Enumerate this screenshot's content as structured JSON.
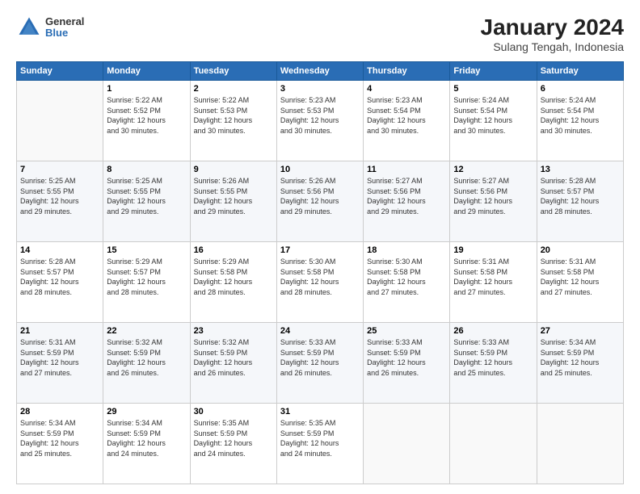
{
  "header": {
    "logo": {
      "general": "General",
      "blue": "Blue"
    },
    "title": "January 2024",
    "subtitle": "Sulang Tengah, Indonesia"
  },
  "calendar": {
    "days_of_week": [
      "Sunday",
      "Monday",
      "Tuesday",
      "Wednesday",
      "Thursday",
      "Friday",
      "Saturday"
    ],
    "weeks": [
      [
        {
          "day": "",
          "info": ""
        },
        {
          "day": "1",
          "info": "Sunrise: 5:22 AM\nSunset: 5:52 PM\nDaylight: 12 hours\nand 30 minutes."
        },
        {
          "day": "2",
          "info": "Sunrise: 5:22 AM\nSunset: 5:53 PM\nDaylight: 12 hours\nand 30 minutes."
        },
        {
          "day": "3",
          "info": "Sunrise: 5:23 AM\nSunset: 5:53 PM\nDaylight: 12 hours\nand 30 minutes."
        },
        {
          "day": "4",
          "info": "Sunrise: 5:23 AM\nSunset: 5:54 PM\nDaylight: 12 hours\nand 30 minutes."
        },
        {
          "day": "5",
          "info": "Sunrise: 5:24 AM\nSunset: 5:54 PM\nDaylight: 12 hours\nand 30 minutes."
        },
        {
          "day": "6",
          "info": "Sunrise: 5:24 AM\nSunset: 5:54 PM\nDaylight: 12 hours\nand 30 minutes."
        }
      ],
      [
        {
          "day": "7",
          "info": "Sunrise: 5:25 AM\nSunset: 5:55 PM\nDaylight: 12 hours\nand 29 minutes."
        },
        {
          "day": "8",
          "info": "Sunrise: 5:25 AM\nSunset: 5:55 PM\nDaylight: 12 hours\nand 29 minutes."
        },
        {
          "day": "9",
          "info": "Sunrise: 5:26 AM\nSunset: 5:55 PM\nDaylight: 12 hours\nand 29 minutes."
        },
        {
          "day": "10",
          "info": "Sunrise: 5:26 AM\nSunset: 5:56 PM\nDaylight: 12 hours\nand 29 minutes."
        },
        {
          "day": "11",
          "info": "Sunrise: 5:27 AM\nSunset: 5:56 PM\nDaylight: 12 hours\nand 29 minutes."
        },
        {
          "day": "12",
          "info": "Sunrise: 5:27 AM\nSunset: 5:56 PM\nDaylight: 12 hours\nand 29 minutes."
        },
        {
          "day": "13",
          "info": "Sunrise: 5:28 AM\nSunset: 5:57 PM\nDaylight: 12 hours\nand 28 minutes."
        }
      ],
      [
        {
          "day": "14",
          "info": "Sunrise: 5:28 AM\nSunset: 5:57 PM\nDaylight: 12 hours\nand 28 minutes."
        },
        {
          "day": "15",
          "info": "Sunrise: 5:29 AM\nSunset: 5:57 PM\nDaylight: 12 hours\nand 28 minutes."
        },
        {
          "day": "16",
          "info": "Sunrise: 5:29 AM\nSunset: 5:58 PM\nDaylight: 12 hours\nand 28 minutes."
        },
        {
          "day": "17",
          "info": "Sunrise: 5:30 AM\nSunset: 5:58 PM\nDaylight: 12 hours\nand 28 minutes."
        },
        {
          "day": "18",
          "info": "Sunrise: 5:30 AM\nSunset: 5:58 PM\nDaylight: 12 hours\nand 27 minutes."
        },
        {
          "day": "19",
          "info": "Sunrise: 5:31 AM\nSunset: 5:58 PM\nDaylight: 12 hours\nand 27 minutes."
        },
        {
          "day": "20",
          "info": "Sunrise: 5:31 AM\nSunset: 5:58 PM\nDaylight: 12 hours\nand 27 minutes."
        }
      ],
      [
        {
          "day": "21",
          "info": "Sunrise: 5:31 AM\nSunset: 5:59 PM\nDaylight: 12 hours\nand 27 minutes."
        },
        {
          "day": "22",
          "info": "Sunrise: 5:32 AM\nSunset: 5:59 PM\nDaylight: 12 hours\nand 26 minutes."
        },
        {
          "day": "23",
          "info": "Sunrise: 5:32 AM\nSunset: 5:59 PM\nDaylight: 12 hours\nand 26 minutes."
        },
        {
          "day": "24",
          "info": "Sunrise: 5:33 AM\nSunset: 5:59 PM\nDaylight: 12 hours\nand 26 minutes."
        },
        {
          "day": "25",
          "info": "Sunrise: 5:33 AM\nSunset: 5:59 PM\nDaylight: 12 hours\nand 26 minutes."
        },
        {
          "day": "26",
          "info": "Sunrise: 5:33 AM\nSunset: 5:59 PM\nDaylight: 12 hours\nand 25 minutes."
        },
        {
          "day": "27",
          "info": "Sunrise: 5:34 AM\nSunset: 5:59 PM\nDaylight: 12 hours\nand 25 minutes."
        }
      ],
      [
        {
          "day": "28",
          "info": "Sunrise: 5:34 AM\nSunset: 5:59 PM\nDaylight: 12 hours\nand 25 minutes."
        },
        {
          "day": "29",
          "info": "Sunrise: 5:34 AM\nSunset: 5:59 PM\nDaylight: 12 hours\nand 24 minutes."
        },
        {
          "day": "30",
          "info": "Sunrise: 5:35 AM\nSunset: 5:59 PM\nDaylight: 12 hours\nand 24 minutes."
        },
        {
          "day": "31",
          "info": "Sunrise: 5:35 AM\nSunset: 5:59 PM\nDaylight: 12 hours\nand 24 minutes."
        },
        {
          "day": "",
          "info": ""
        },
        {
          "day": "",
          "info": ""
        },
        {
          "day": "",
          "info": ""
        }
      ]
    ]
  }
}
